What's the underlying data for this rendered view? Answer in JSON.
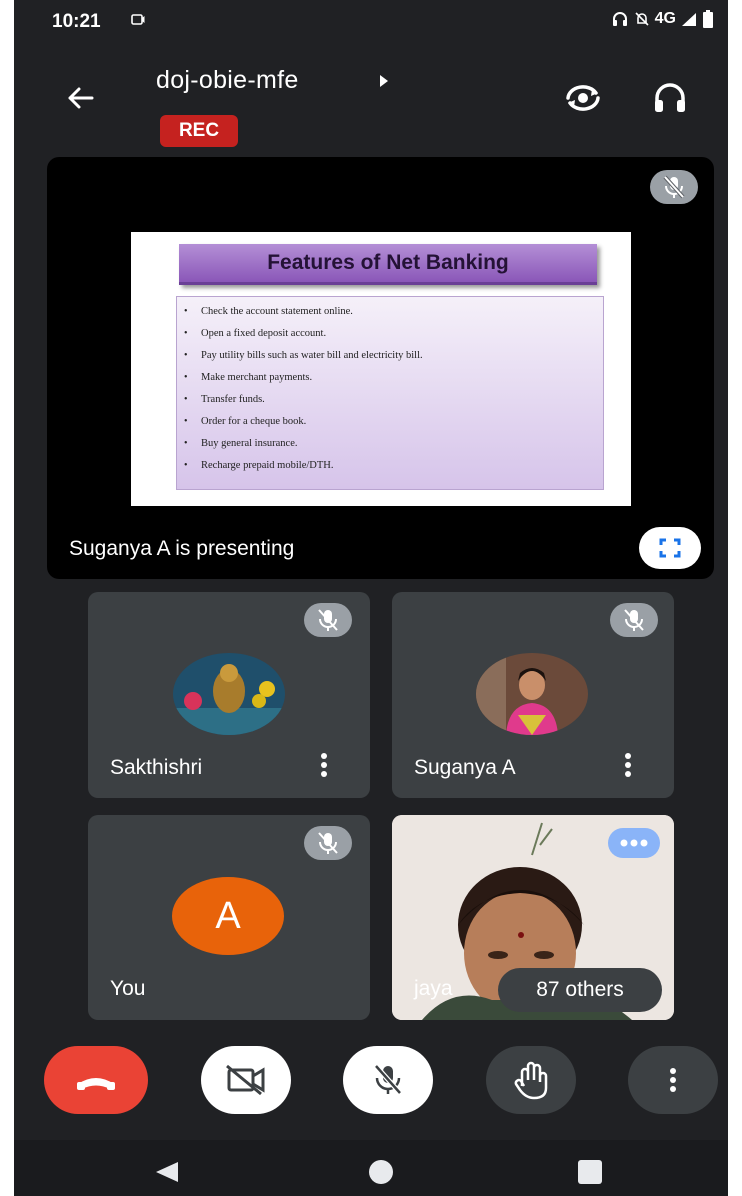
{
  "status_bar": {
    "time": "10:21",
    "network": "4G"
  },
  "header": {
    "meeting_code": "doj-obie-mfe",
    "rec_label": "REC"
  },
  "presentation": {
    "presenter_label": "Suganya A is presenting",
    "slide": {
      "title": "Features of Net Banking",
      "bullets": [
        "Check the account statement online.",
        "Open a fixed deposit account.",
        "Pay utility bills such as water bill and electricity bill.",
        "Make merchant payments.",
        "Transfer funds.",
        "Order for a cheque book.",
        "Buy general insurance.",
        "Recharge prepaid mobile/DTH."
      ]
    }
  },
  "participants": [
    {
      "name": "Sakthishri",
      "muted": true
    },
    {
      "name": "Suganya A",
      "muted": true
    },
    {
      "name": "You",
      "initial": "A",
      "muted": true
    },
    {
      "name": "jaya",
      "muted": false
    }
  ],
  "others_label": "87 others",
  "colors": {
    "background": "#202124",
    "tile": "#3c4043",
    "rec": "#c5221f",
    "hangup": "#ea4335",
    "avatar": "#e8630a",
    "accent": "#1a73e8"
  },
  "icons": {
    "back": "arrow-left-icon",
    "switch_camera": "switch-camera-icon",
    "audio_output": "headphones-icon",
    "mic_off": "mic-off-icon",
    "fullscreen": "fullscreen-icon",
    "more": "more-vert-icon",
    "hangup": "phone-hangup-icon",
    "camera_off": "camera-off-icon",
    "raise_hand": "raise-hand-icon"
  }
}
